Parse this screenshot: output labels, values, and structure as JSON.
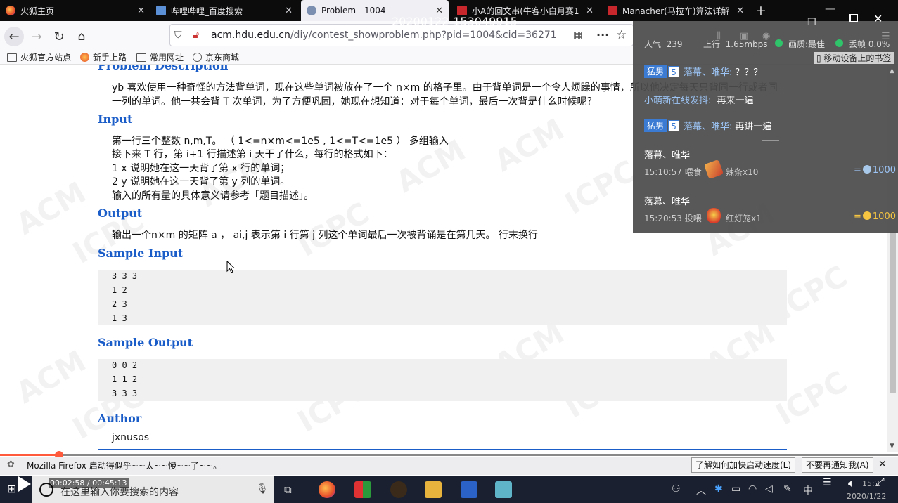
{
  "recording_timestamp": "20200122-153049915",
  "tabs": [
    {
      "title": "火狐主页",
      "active": false
    },
    {
      "title": "哔哩哔哩_百度搜索",
      "active": false
    },
    {
      "title": "Problem - 1004",
      "active": true
    },
    {
      "title": "小A的回文串(牛客小白月赛1",
      "active": false
    },
    {
      "title": "Manacher(马拉车)算法详解",
      "active": false
    }
  ],
  "url": {
    "host": "acm.hdu.edu.cn",
    "path": "/diy/contest_showproblem.php?pid=1004&cid=36271"
  },
  "bookmarks": [
    "火狐官方站点",
    "新手上路",
    "常用网址",
    "京东商城"
  ],
  "problem": {
    "desc_heading": "Problem Description",
    "desc_line1": "yb 喜欢使用一种奇怪的方法背单词，现在这些单词被放在了一个 n×m 的格子里。由于背单词是一个令人烦躁的事情，所以他决定每天只背同一行或者同",
    "desc_line2": "一列的单词。他一共会背 T 次单词，为了方便巩固，她现在想知道：对于每个单词，最后一次背是什么时候呢？",
    "input_heading": "Input",
    "input_lines": [
      "第一行三个整数 n,m,T。 （ 1<=n×m<=1e5 , 1<=T<=1e5 ） 多组输入",
      "接下来 T 行，第 i+1 行描述第 i 天干了什么，每行的格式如下：",
      "1 x 说明她在这一天背了第 x 行的单词；",
      "2 y 说明她在这一天背了第 y 列的单词。",
      "输入的所有量的具体意义请参考「题目描述」。"
    ],
    "output_heading": "Output",
    "output_line": "输出一个n×m 的矩阵 a ， ai,j 表示第 i 行第 j 列这个单词最后一次被背诵是在第几天。 行末换行",
    "sample_input_heading": "Sample Input",
    "sample_input": [
      "3 3 3",
      "1 2",
      "2 3",
      "1 3"
    ],
    "sample_output_heading": "Sample Output",
    "sample_output": [
      "0 0 2",
      "1 1 2",
      "3 3 3"
    ],
    "author_heading": "Author",
    "author": "jxnusos"
  },
  "watermark": [
    "ACM",
    "ICPC"
  ],
  "stream_panel": {
    "popularity_label": "人气",
    "popularity": "239",
    "upload_label": "上行",
    "upload": "1.65mbps",
    "quality_label": "画质:",
    "quality": "最佳",
    "drop_label": "丢帧",
    "drop": "0.0%",
    "move_bookmark": "移动设备上的书签",
    "chat": [
      {
        "badge": "猛男",
        "level": "5",
        "user": "落幕、唯华:",
        "msg": "？？？"
      },
      {
        "badge": "",
        "level": "",
        "user": "小萌新在线发抖:",
        "msg": "再来一遍"
      },
      {
        "badge": "猛男",
        "level": "5",
        "user": "落幕、唯华:",
        "msg": "再讲一遍"
      }
    ],
    "gifts": [
      {
        "user": "落幕、唯华",
        "time": "15:10:57",
        "action": "喂食",
        "item": "辣条x10",
        "amount": "1000"
      },
      {
        "user": "落幕、唯华",
        "time": "15:20:53",
        "action": "投喂",
        "item": "红灯笼x1",
        "amount": "1000"
      }
    ]
  },
  "video": {
    "current": "00:02:58",
    "total": "00:45:13",
    "progress_fraction": 0.066
  },
  "notification": {
    "text": "Mozilla Firefox 启动得似乎~~太~~慢~~了~~。",
    "btn_learn": "了解如何加快启动速度(L)",
    "btn_dismiss": "不要再通知我(A)"
  },
  "taskbar": {
    "search_placeholder": "在这里输入你要搜索的内容",
    "clock_time": "15:3",
    "clock_date": "2020/1/22",
    "ime": "中"
  }
}
